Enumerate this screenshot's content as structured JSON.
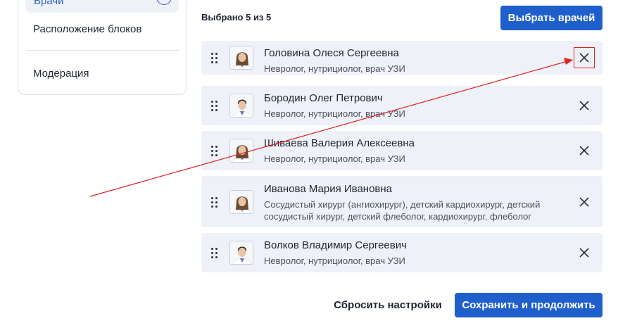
{
  "sidebar": {
    "active_item": "Врачи",
    "items": [
      {
        "label": "Расположение блоков"
      },
      {
        "label": "Модерация"
      }
    ]
  },
  "header": {
    "selected_text": "Выбрано 5 из 5",
    "select_button": "Выбрать врачей"
  },
  "doctors": [
    {
      "name": "Головина Олеся Сергеевна",
      "specialty": "Невролог, нутрициолог, врач УЗИ",
      "avatar": "female-doctor-avatar"
    },
    {
      "name": "Бородин Олег Петрович",
      "specialty": "Невролог, нутрициолог, врач УЗИ",
      "avatar": "male-doctor-avatar"
    },
    {
      "name": "Шиваева Валерия Алексеевна",
      "specialty": "Невролог, нутрициолог, врач УЗИ",
      "avatar": "female-doctor-avatar"
    },
    {
      "name": "Иванова Мария Ивановна",
      "specialty": "Сосудистый хирург (ангиохирург), детский кардиохирург, детский сосудистый хирург, детский флеболог, кардиохирург, флеболог",
      "avatar": "female-doctor-avatar"
    },
    {
      "name": "Волков Владимир Сергеевич",
      "specialty": "Невролог, нутрициолог, врач УЗИ",
      "avatar": "male-doctor-avatar"
    }
  ],
  "footer": {
    "reset_button": "Сбросить настройки",
    "save_button": "Сохранить и продолжить"
  },
  "icons": {
    "drag": "drag-handle-icon",
    "remove": "close-icon"
  },
  "colors": {
    "primary": "#1f5fcc",
    "row_background": "#eef1f8",
    "annotation": "#e02020"
  }
}
